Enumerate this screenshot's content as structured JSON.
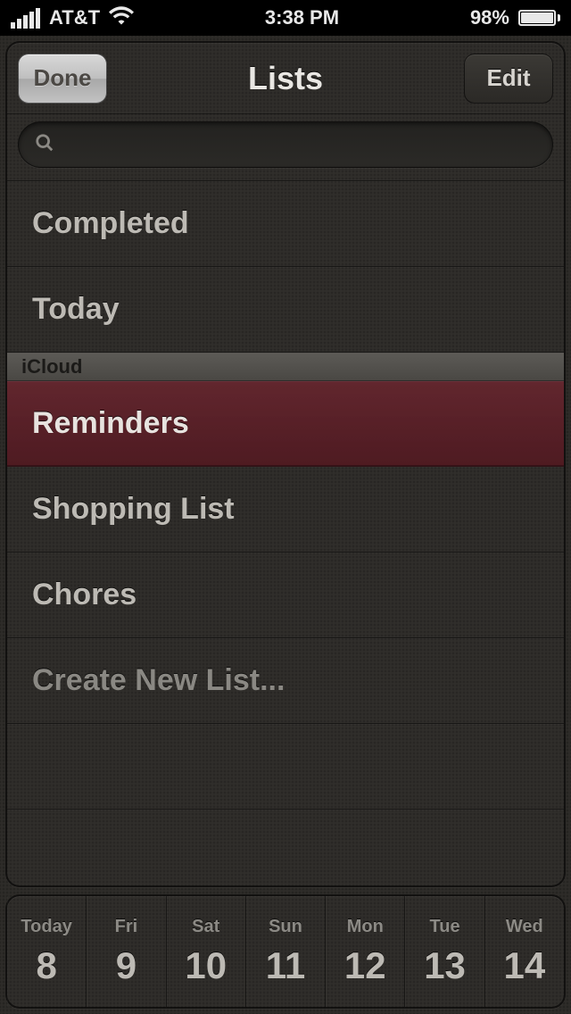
{
  "status": {
    "carrier": "AT&T",
    "time": "3:38 PM",
    "battery_pct": "98%"
  },
  "nav": {
    "done": "Done",
    "title": "Lists",
    "edit": "Edit"
  },
  "search": {
    "placeholder": ""
  },
  "lists": {
    "smart": [
      {
        "label": "Completed"
      },
      {
        "label": "Today"
      }
    ],
    "section": "iCloud",
    "user": [
      {
        "label": "Reminders",
        "selected": true
      },
      {
        "label": "Shopping List"
      },
      {
        "label": "Chores"
      }
    ],
    "create": "Create New List..."
  },
  "dates": [
    {
      "label": "Today",
      "num": "8"
    },
    {
      "label": "Fri",
      "num": "9"
    },
    {
      "label": "Sat",
      "num": "10"
    },
    {
      "label": "Sun",
      "num": "11"
    },
    {
      "label": "Mon",
      "num": "12"
    },
    {
      "label": "Tue",
      "num": "13"
    },
    {
      "label": "Wed",
      "num": "14"
    }
  ]
}
